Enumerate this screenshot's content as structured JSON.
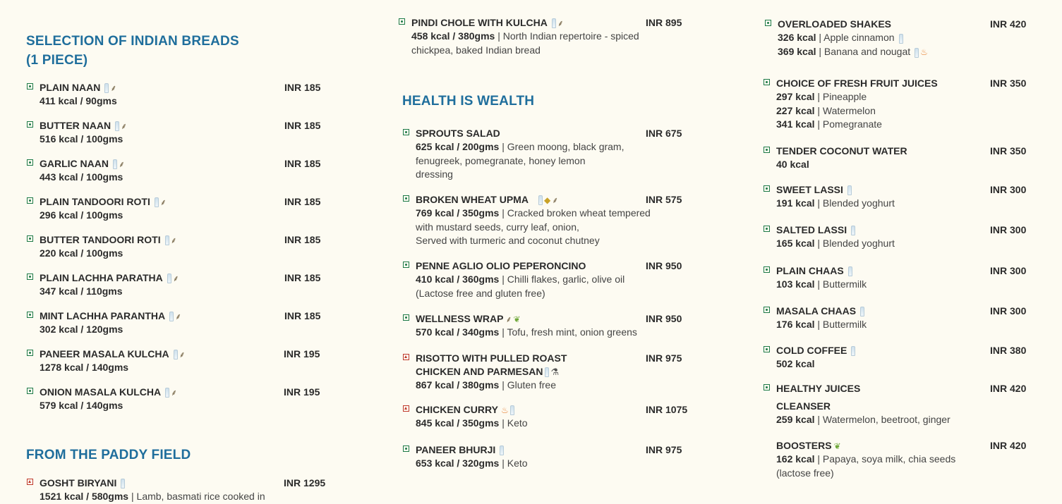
{
  "columns": {
    "left": {
      "breads_title_1": "SELECTION OF INDIAN BREADS",
      "breads_title_2": "(1 PIECE)",
      "breads": [
        {
          "name": "PLAIN NAAN",
          "price": "INR 185",
          "info": "411 kcal / 90gms",
          "icons": [
            "milk-icon",
            "wheat-icon"
          ]
        },
        {
          "name": "BUTTER NAAN",
          "price": "INR 185",
          "info": "516 kcal / 100gms",
          "icons": [
            "milk-icon",
            "wheat-icon"
          ]
        },
        {
          "name": "GARLIC NAAN",
          "price": "INR 185",
          "info": "443 kcal / 100gms",
          "icons": [
            "milk-icon",
            "wheat-icon"
          ]
        },
        {
          "name": "PLAIN TANDOORI ROTI",
          "price": "INR 185",
          "info": "296 kcal / 100gms",
          "icons": [
            "milk-icon",
            "wheat-icon"
          ]
        },
        {
          "name": "BUTTER TANDOORI ROTI",
          "price": "INR 185",
          "info": "220 kcal / 100gms",
          "icons": [
            "milk-icon",
            "wheat-icon"
          ]
        },
        {
          "name": "PLAIN LACHHA PARATHA",
          "price": "INR 185",
          "info": "347 kcal / 110gms",
          "icons": [
            "milk-icon",
            "wheat-icon"
          ]
        },
        {
          "name": "MINT LACHHA PARANTHA",
          "price": "INR 185",
          "info": "302 kcal / 120gms",
          "icons": [
            "milk-icon",
            "wheat-icon"
          ]
        },
        {
          "name": "PANEER MASALA KULCHA",
          "price": "INR 195",
          "info": "1278 kcal / 140gms",
          "icons": [
            "milk-icon",
            "wheat-icon"
          ]
        },
        {
          "name": "ONION MASALA KULCHA",
          "price": "INR 195",
          "info": "579 kcal / 140gms",
          "icons": [
            "milk-icon",
            "wheat-icon"
          ]
        }
      ],
      "paddy_title": "FROM THE PADDY FIELD",
      "biryani": {
        "name": "GOSHT BIRYANI",
        "price": "INR 1295",
        "kcal": "1521 kcal / 580gms",
        "text": "| Lamb, basmati rice cooked in"
      }
    },
    "middle": {
      "top_item": {
        "name": "PINDI CHOLE WITH KULCHA",
        "price": "INR 895",
        "kcal": "458 kcal / 380gms",
        "text1": "| North Indian repertoire - spiced",
        "text2": "chickpea, baked Indian bread"
      },
      "health_title": "HEALTH IS WEALTH",
      "items": [
        {
          "name": "SPROUTS SALAD",
          "price": "INR 675",
          "kcal": "625 kcal / 200gms",
          "lines": [
            "| Green moong, black gram,",
            "fenugreek, pomegranate, honey lemon",
            "dressing"
          ]
        },
        {
          "name": "BROKEN WHEAT UPMA",
          "price": "INR 575",
          "kcal": "769 kcal / 350gms",
          "lines": [
            "| Cracked broken wheat tempered",
            "with mustard seeds, curry leaf, onion,",
            "Served with turmeric and coconut chutney"
          ]
        },
        {
          "name": "PENNE AGLIO OLIO PEPERONCINO",
          "price": "INR 950",
          "kcal": "410 kcal / 360gms",
          "lines": [
            "| Chilli flakes, garlic, olive oil",
            "(Lactose free and gluten free)"
          ]
        },
        {
          "name": "WELLNESS WRAP",
          "price": "INR 950",
          "kcal": "570 kcal / 340gms",
          "lines": [
            "| Tofu, fresh mint, onion greens"
          ]
        },
        {
          "name": "RISOTTO WITH PULLED ROAST",
          "name2": "CHICKEN AND PARMESAN",
          "price": "INR 975",
          "kcal": "867 kcal / 380gms",
          "lines": [
            " | Gluten free"
          ]
        },
        {
          "name": "CHICKEN CURRY",
          "price": "INR 1075",
          "kcal": "845 kcal / 350gms",
          "lines": [
            "| Keto"
          ]
        },
        {
          "name": "PANEER BHURJI",
          "price": "INR 975",
          "kcal": "653 kcal / 320gms",
          "lines": [
            " | Keto"
          ]
        }
      ]
    },
    "right": {
      "shakes": {
        "name": "OVERLOADED SHAKES",
        "price": "INR 420",
        "rows": [
          {
            "kcal": "326 kcal",
            "text": "| Apple cinnamon"
          },
          {
            "kcal": "369 kcal",
            "text": "| Banana and nougat"
          }
        ]
      },
      "juices": {
        "name": "CHOICE OF FRESH FRUIT JUICES",
        "price": "INR 350",
        "rows": [
          {
            "kcal": "297 kcal",
            "text": "| Pineapple"
          },
          {
            "kcal": "227 kcal",
            "text": "| Watermelon"
          },
          {
            "kcal": "341 kcal",
            "text": "| Pomegranate"
          }
        ]
      },
      "coconut": {
        "name": "TENDER COCONUT WATER",
        "price": "INR 350",
        "kcal": "40 kcal"
      },
      "sweet_lassi": {
        "name": "SWEET LASSI",
        "price": "INR 300",
        "kcal": "191 kcal",
        "text": "| Blended yoghurt"
      },
      "salted_lassi": {
        "name": "SALTED LASSI",
        "price": "INR 300",
        "kcal": "165 kcal",
        "text": "| Blended yoghurt"
      },
      "plain_chaas": {
        "name": "PLAIN CHAAS",
        "price": "INR 300",
        "kcal": "103 kcal",
        "text": "| Buttermilk"
      },
      "masala_chaas": {
        "name": "MASALA CHAAS",
        "price": "INR 300",
        "kcal": "176 kcal",
        "text": "| Buttermilk"
      },
      "cold_coffee": {
        "name": "COLD COFFEE",
        "price": "INR 380",
        "kcal": "502 kcal"
      },
      "healthy_juices": {
        "name": "HEALTHY JUICES",
        "price": "INR 420",
        "sub": "CLEANSER",
        "kcal": "259 kcal",
        "text": "| Watermelon, beetroot, ginger"
      },
      "boosters": {
        "name": "BOOSTERS",
        "price": "INR 420",
        "kcal": "162 kcal",
        "text": "| Papaya, soya milk, chia seeds",
        "text2": "(lactose free)"
      }
    }
  }
}
